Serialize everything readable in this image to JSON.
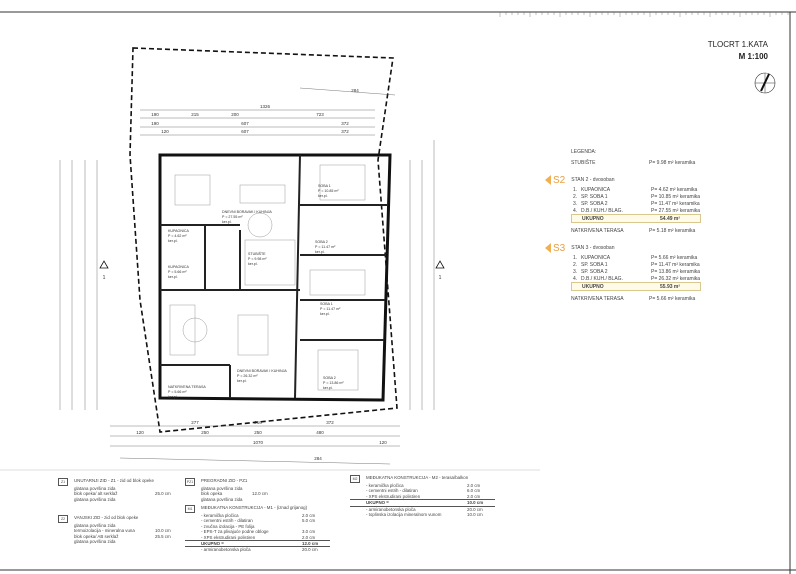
{
  "title": "TLOCRT 1.KATA",
  "scale": "M 1:100",
  "icons": {
    "north": "north-arrow-icon",
    "section": "section-marker-icon"
  },
  "colors": {
    "accent": "#f0b050",
    "lines": "#222222"
  },
  "plan": {
    "dims_top": [
      "284",
      "1326",
      "190",
      "215",
      "200",
      "723",
      "190",
      "607",
      "372",
      "120",
      "607",
      "372"
    ],
    "dims_bottom": [
      "277",
      "216",
      "372",
      "120",
      "250",
      "250",
      "480",
      "1070",
      "120",
      "284"
    ],
    "section_labels": [
      "1",
      "1"
    ],
    "rooms": [
      {
        "name": "SOBA 1",
        "area": "P = 10.85 m²",
        "floor": "ker.pl."
      },
      {
        "name": "SOBA 2",
        "area": "P = 11.47 m²",
        "floor": "ker.pl."
      },
      {
        "name": "DNEVNI BORAVAK I KUHINJA",
        "area": "P = 27.55 m²",
        "floor": "ker.pl."
      },
      {
        "name": "KUPAONICA",
        "area": "P = 4.62 m²",
        "floor": "ker.pl."
      },
      {
        "name": "KUPAONICA",
        "area": "P = 5.66 m²",
        "floor": "ker.pl."
      },
      {
        "name": "STUBIŠTE",
        "area": "P = 9.98 m²",
        "floor": "ker.pl."
      },
      {
        "name": "SOBA 1",
        "area": "P = 11.47 m²",
        "floor": "ker.pl."
      },
      {
        "name": "DNEVNI BORAVAK I KUHINJA",
        "area": "P = 26.32 m²",
        "floor": "ker.pl."
      },
      {
        "name": "SOBA 2",
        "area": "P = 13.86 m²",
        "floor": "ker.pl."
      },
      {
        "name": "NATKRIVENA TERASA",
        "area": "P = 5.66 m²",
        "floor": "ker.pl."
      }
    ]
  },
  "legend": {
    "heading": "LEGENDA:",
    "stairs": {
      "name": "STUBIŠTE",
      "area": "P= 9.98 m² keramika"
    },
    "units": [
      {
        "badge": "S2",
        "title": "STAN 2 - dvosoban",
        "rooms": [
          {
            "n": "1.",
            "name": "KUPAONICA",
            "area": "P= 4.62 m² keramika"
          },
          {
            "n": "2.",
            "name": "SP. SOBA 1",
            "area": "P= 10.85 m² keramika"
          },
          {
            "n": "3.",
            "name": "SP. SOBA 2",
            "area": "P= 11.47 m² keramika"
          },
          {
            "n": "4.",
            "name": "D.B./ KUH./ BLAG.",
            "area": "P= 27.55 m² keramika"
          }
        ],
        "total_label": "UKUPNO",
        "total": "54.49 m²",
        "terrace": {
          "name": "NATKRIVENA TERASA",
          "area": "P= 5.18 m² keramika"
        }
      },
      {
        "badge": "S3",
        "title": "STAN 3 - dvosoban",
        "rooms": [
          {
            "n": "1.",
            "name": "KUPAONICA",
            "area": "P= 5.66 m² keramika"
          },
          {
            "n": "2.",
            "name": "SP. SOBA 1",
            "area": "P= 11.47 m² keramika"
          },
          {
            "n": "3.",
            "name": "SP. SOBA 2",
            "area": "P= 13.86 m² keramika"
          },
          {
            "n": "4.",
            "name": "D.B./ KUH./ BLAG.",
            "area": "P= 26.32 m² keramika"
          }
        ],
        "total_label": "UKUPNO",
        "total": "55.93 m²",
        "terrace": {
          "name": "NATKRIVENA TERASA",
          "area": "P= 5.66 m² keramika"
        }
      }
    ]
  },
  "notes": [
    {
      "code": "Z1",
      "title": "UNUTARNJI ZID - Z1 - zid od blok opeke",
      "lines": [
        [
          "glatana površina zida",
          ""
        ],
        [
          "blok opeka/ alt serklaž",
          "25.0 cm"
        ],
        [
          "glatana površina zida",
          ""
        ]
      ]
    },
    {
      "code": "Z2",
      "title": "VANJSKI ZID - zid od blok opeke",
      "lines": [
        [
          "glatana površina zida",
          ""
        ],
        [
          "termoizolacija - mineralna vuna",
          "10.0 cm"
        ],
        [
          "blok opeka/ AB serklaž",
          "25.5 cm"
        ],
        [
          "glatana površina zida",
          ""
        ]
      ]
    },
    {
      "code": "PZ1",
      "title": "PREGRADNI ZID - PZ1",
      "lines": [
        [
          "glatana površina zida",
          ""
        ],
        [
          "blok opeka",
          "12.0 cm"
        ],
        [
          "glatana površina zida",
          ""
        ]
      ]
    },
    {
      "code": "M1",
      "title": "MEĐUKATNA KONSTRUKCIJA - M1 - (iznad grijanog)",
      "lines": [
        [
          "- keramička pločica",
          "2.0 cm"
        ],
        [
          "- cementni estrih - dilatiran",
          "5.0 cm"
        ],
        [
          "- zvučna izolacija - PE folija",
          ""
        ],
        [
          "- EPS-T za plivajuće podne obloge",
          "3.0 cm"
        ],
        [
          "- XPS ekstrudirani polistiren",
          "2.0 cm"
        ]
      ],
      "sum": [
        "UKUPNO =",
        "12.0 cm"
      ],
      "after": [
        [
          "- armiranobetonska ploča",
          "20.0 cm"
        ]
      ]
    },
    {
      "code": "M2",
      "title": "MEĐUKATNA KONSTRUKCIJA - M2 - terasa/balkon",
      "lines": [
        [
          "- keramička pločica",
          "2.0 cm"
        ],
        [
          "- cementni estrih - dilatiran",
          "6.0 cm"
        ],
        [
          "- XPS ekstrudirani polistiren",
          "2.0 cm"
        ]
      ],
      "sum": [
        "UKUPNO =",
        "10.0 cm"
      ],
      "after": [
        [
          "- armiranobetonska ploča",
          "20.0 cm"
        ],
        [
          "- toplinska izolacija mineralnom vunom",
          "10.0 cm"
        ]
      ]
    }
  ]
}
